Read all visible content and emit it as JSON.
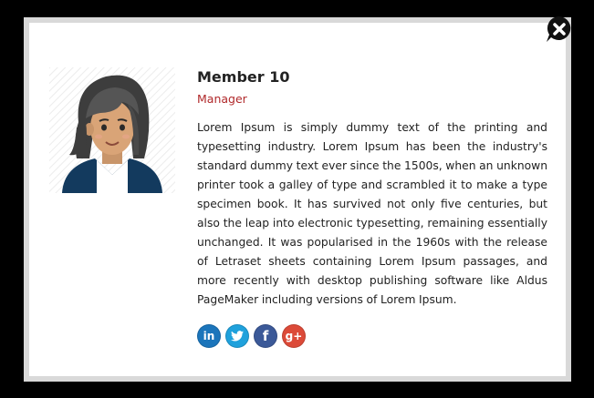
{
  "member": {
    "name": "Member 10",
    "role": "Manager",
    "bio": "Lorem Ipsum is simply dummy text of the printing and typesetting industry. Lorem Ipsum has been the industry's standard dummy text ever since the 1500s, when an unknown printer took a galley of type and scrambled it to make a type specimen book. It has survived not only five centuries, but also the leap into electronic typesetting, remaining essentially unchanged. It was popularised in the 1960s with the release of Letraset sheets containing Lorem Ipsum passages, and more recently with desktop publishing software like Aldus PageMaker including versions of Lorem Ipsum."
  },
  "social": [
    {
      "icon": "linkedin-icon",
      "glyph": "in",
      "color": "#1b75bb"
    },
    {
      "icon": "twitter-icon",
      "glyph": "t",
      "color": "#1fa1dc"
    },
    {
      "icon": "facebook-icon",
      "glyph": "f",
      "color": "#3b5998"
    },
    {
      "icon": "google-plus-icon",
      "glyph": "g+",
      "color": "#dc4a38"
    }
  ],
  "close": {
    "icon": "close-icon"
  },
  "colors": {
    "role": "#b0282a",
    "overlay": "#000000",
    "frame": "#d9d9d9"
  }
}
